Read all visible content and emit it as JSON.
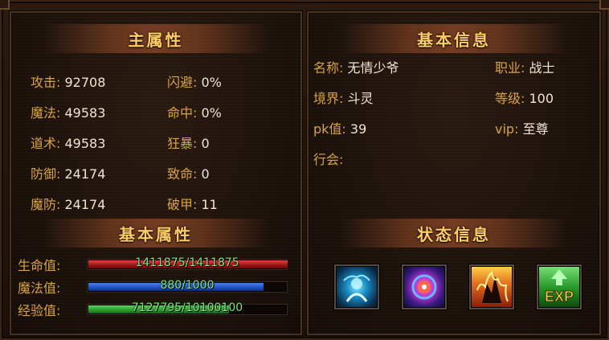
{
  "main_attributes": {
    "title": "主属性",
    "left": [
      {
        "label": "攻击:",
        "value": "92708"
      },
      {
        "label": "魔法:",
        "value": "49583"
      },
      {
        "label": "道术:",
        "value": "49583"
      },
      {
        "label": "防御:",
        "value": "24174"
      },
      {
        "label": "魔防:",
        "value": "24174"
      }
    ],
    "right": [
      {
        "label": "闪避:",
        "value": "0%"
      },
      {
        "label": "命中:",
        "value": "0%"
      },
      {
        "label": "狂暴:",
        "value": "0"
      },
      {
        "label": "致命:",
        "value": "0"
      },
      {
        "label": "破甲:",
        "value": "11"
      }
    ]
  },
  "basic_attributes": {
    "title": "基本属性",
    "bars": [
      {
        "label": "生命值:",
        "text": "1411875/1411875",
        "fraction": 1.0,
        "color": "#b52020"
      },
      {
        "label": "魔法值:",
        "text": "880/1000",
        "fraction": 0.88,
        "color": "#2a5fd4"
      },
      {
        "label": "经验值:",
        "text": "7127795/10100100",
        "fraction": 0.7057,
        "color": "#2faa2f"
      }
    ]
  },
  "basic_info": {
    "title": "基本信息",
    "rows": [
      {
        "label": "名称:",
        "value": "无情少爷"
      },
      {
        "label": "境界:",
        "value": "斗灵"
      },
      {
        "label": "pk值:",
        "value": "39"
      },
      {
        "label": "行会:",
        "value": ""
      }
    ],
    "right_rows": [
      {
        "label": "职业:",
        "value": "战士"
      },
      {
        "label": "等级:",
        "value": "100"
      },
      {
        "label": "vip:",
        "value": "至尊"
      }
    ]
  },
  "status_info": {
    "title": "状态信息",
    "icons": [
      {
        "name": "blue-spirit-buff-icon",
        "color": "#2aa8d8"
      },
      {
        "name": "purple-orb-buff-icon",
        "color": "#8a3ad8"
      },
      {
        "name": "fire-rage-buff-icon",
        "color": "#e06a1a"
      },
      {
        "name": "exp-boost-icon",
        "color": "#3bbf3b",
        "text": "EXP"
      }
    ]
  }
}
